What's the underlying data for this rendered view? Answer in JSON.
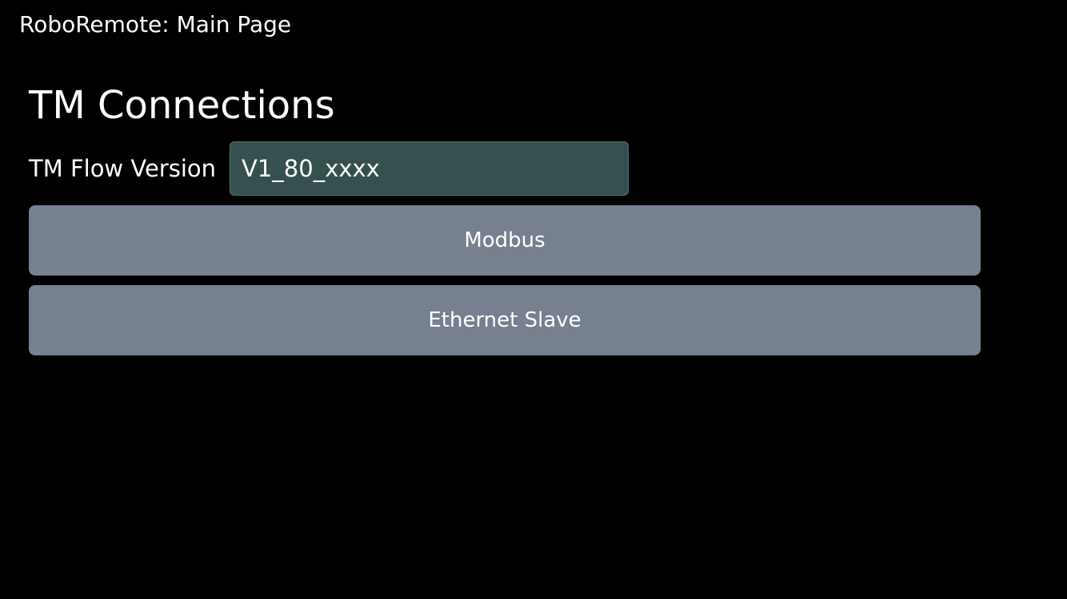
{
  "app": {
    "title": "RoboRemote: Main Page"
  },
  "section": {
    "heading": "TM Connections"
  },
  "tm_flow_version": {
    "label": "TM Flow Version",
    "value": "V1_80_xxxx"
  },
  "buttons": {
    "modbus_label": "Modbus",
    "ethernet_slave_label": "Ethernet Slave"
  },
  "colors": {
    "background": "#000000",
    "input_background": "#364f4f",
    "button_background": "#76808f",
    "text": "#ffffff"
  }
}
